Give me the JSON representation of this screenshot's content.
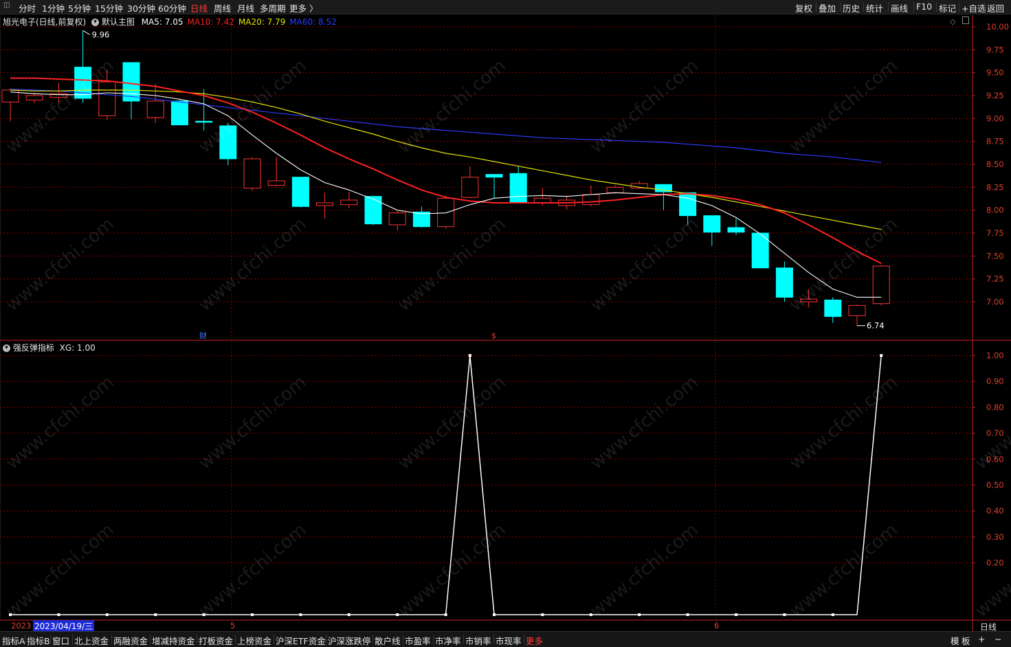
{
  "toolbar": {
    "left_items": [
      "分时",
      "1分钟",
      "5分钟",
      "15分钟",
      "30分钟",
      "60分钟",
      "日线",
      "周线",
      "月线",
      "多周期",
      "更多 〉"
    ],
    "active_index": 6,
    "right_items": [
      "复权",
      "叠加",
      "历史",
      "统计",
      "画线",
      "F10",
      "标记",
      "+自选",
      "返回"
    ]
  },
  "main_chart": {
    "stock_label": "旭光电子(日线,前复权)",
    "main_chart_label": "默认主图",
    "ma": [
      {
        "name": "MA5",
        "value": "MA5: 7.05",
        "color": "#ffffff"
      },
      {
        "name": "MA10",
        "value": "MA10: 7.42",
        "color": "#ff2222"
      },
      {
        "name": "MA20",
        "value": "MA20: 7.79",
        "color": "#e6e600"
      },
      {
        "name": "MA60",
        "value": "MA60: 8.52",
        "color": "#2a3bff"
      }
    ],
    "y_ticks": [
      "10.00",
      "9.75",
      "9.50",
      "9.25",
      "9.00",
      "8.75",
      "8.50",
      "8.25",
      "8.00",
      "7.75",
      "7.50",
      "7.25",
      "7.00"
    ],
    "high_label": "9.96",
    "low_label": "6.74",
    "marker_cai": "财",
    "marker_dollar": "$",
    "candles": [
      {
        "o": 9.18,
        "c": 9.31,
        "h": 9.33,
        "l": 8.97
      },
      {
        "o": 9.2,
        "c": 9.25,
        "h": 9.28,
        "l": 9.17
      },
      {
        "o": 9.23,
        "c": 9.27,
        "h": 9.39,
        "l": 9.17
      },
      {
        "o": 9.56,
        "c": 9.22,
        "h": 9.96,
        "l": 9.17
      },
      {
        "o": 9.03,
        "c": 9.4,
        "h": 9.53,
        "l": 8.98
      },
      {
        "o": 9.61,
        "c": 9.19,
        "h": 9.61,
        "l": 8.99
      },
      {
        "o": 9.01,
        "c": 9.19,
        "h": 9.38,
        "l": 8.95
      },
      {
        "o": 9.19,
        "c": 8.93,
        "h": 9.2,
        "l": 8.93
      },
      {
        "o": 8.97,
        "c": 8.96,
        "h": 9.32,
        "l": 8.87
      },
      {
        "o": 8.92,
        "c": 8.56,
        "h": 8.95,
        "l": 8.49
      },
      {
        "o": 8.24,
        "c": 8.56,
        "h": 8.58,
        "l": 8.21
      },
      {
        "o": 8.27,
        "c": 8.32,
        "h": 8.58,
        "l": 8.26
      },
      {
        "o": 8.36,
        "c": 8.04,
        "h": 8.36,
        "l": 8.03
      },
      {
        "o": 8.05,
        "c": 8.08,
        "h": 8.19,
        "l": 7.91
      },
      {
        "o": 8.06,
        "c": 8.11,
        "h": 8.2,
        "l": 8.02
      },
      {
        "o": 8.15,
        "c": 7.85,
        "h": 8.16,
        "l": 7.84
      },
      {
        "o": 7.84,
        "c": 7.97,
        "h": 7.99,
        "l": 7.78
      },
      {
        "o": 7.98,
        "c": 7.82,
        "h": 8.04,
        "l": 7.81
      },
      {
        "o": 7.82,
        "c": 8.13,
        "h": 8.16,
        "l": 7.8
      },
      {
        "o": 8.14,
        "c": 8.36,
        "h": 8.48,
        "l": 8.13
      },
      {
        "o": 8.39,
        "c": 8.36,
        "h": 8.39,
        "l": 8.13
      },
      {
        "o": 8.4,
        "c": 8.09,
        "h": 8.48,
        "l": 8.08
      },
      {
        "o": 8.08,
        "c": 8.13,
        "h": 8.24,
        "l": 8.05
      },
      {
        "o": 8.05,
        "c": 8.11,
        "h": 8.16,
        "l": 8.01
      },
      {
        "o": 8.06,
        "c": 8.17,
        "h": 8.27,
        "l": 8.04
      },
      {
        "o": 8.19,
        "c": 8.25,
        "h": 8.27,
        "l": 8.18
      },
      {
        "o": 8.24,
        "c": 8.29,
        "h": 8.32,
        "l": 8.23
      },
      {
        "o": 8.28,
        "c": 8.2,
        "h": 8.28,
        "l": 8.0
      },
      {
        "o": 8.19,
        "c": 7.94,
        "h": 8.19,
        "l": 7.84
      },
      {
        "o": 7.94,
        "c": 7.76,
        "h": 7.94,
        "l": 7.61
      },
      {
        "o": 7.81,
        "c": 7.76,
        "h": 7.91,
        "l": 7.73
      },
      {
        "o": 7.75,
        "c": 7.37,
        "h": 7.75,
        "l": 7.37
      },
      {
        "o": 7.37,
        "c": 7.05,
        "h": 7.44,
        "l": 7.0
      },
      {
        "o": 7.0,
        "c": 7.03,
        "h": 7.14,
        "l": 6.94
      },
      {
        "o": 7.02,
        "c": 6.84,
        "h": 7.05,
        "l": 6.77
      },
      {
        "o": 6.85,
        "c": 6.96,
        "h": 6.97,
        "l": 6.74
      },
      {
        "o": 6.98,
        "c": 7.39,
        "h": 7.4,
        "l": 6.96
      }
    ],
    "ma5": [
      9.29,
      9.27,
      9.26,
      9.26,
      9.28,
      9.27,
      9.25,
      9.21,
      9.16,
      9.03,
      8.82,
      8.62,
      8.44,
      8.3,
      8.22,
      8.12,
      8.0,
      7.96,
      7.97,
      8.06,
      8.13,
      8.15,
      8.16,
      8.15,
      8.17,
      8.19,
      8.18,
      8.17,
      8.13,
      8.05,
      7.92,
      7.74,
      7.53,
      7.32,
      7.14,
      7.05,
      7.05
    ],
    "ma10": [
      9.44,
      9.44,
      9.43,
      9.42,
      9.41,
      9.38,
      9.35,
      9.3,
      9.25,
      9.17,
      9.07,
      8.95,
      8.82,
      8.68,
      8.56,
      8.45,
      8.33,
      8.22,
      8.14,
      8.1,
      8.08,
      8.08,
      8.08,
      8.08,
      8.09,
      8.11,
      8.14,
      8.17,
      8.18,
      8.16,
      8.12,
      8.06,
      7.97,
      7.84,
      7.7,
      7.55,
      7.42
    ],
    "ma20": [
      9.31,
      9.3,
      9.3,
      9.31,
      9.31,
      9.31,
      9.3,
      9.29,
      9.27,
      9.23,
      9.18,
      9.12,
      9.05,
      8.97,
      8.9,
      8.83,
      8.75,
      8.68,
      8.62,
      8.58,
      8.53,
      8.48,
      8.43,
      8.38,
      8.33,
      8.29,
      8.25,
      8.22,
      8.18,
      8.14,
      8.09,
      8.04,
      7.99,
      7.94,
      7.89,
      7.84,
      7.79
    ],
    "ma60": [
      9.32,
      9.31,
      9.3,
      9.28,
      9.26,
      9.24,
      9.21,
      9.18,
      9.15,
      9.12,
      9.09,
      9.06,
      9.03,
      9.0,
      8.97,
      8.94,
      8.91,
      8.89,
      8.87,
      8.85,
      8.83,
      8.81,
      8.79,
      8.78,
      8.77,
      8.76,
      8.75,
      8.74,
      8.72,
      8.7,
      8.68,
      8.65,
      8.62,
      8.6,
      8.58,
      8.55,
      8.52
    ]
  },
  "sub_chart": {
    "indicator_label": "强反弹指标",
    "xg_label": "XG: 1.00",
    "y_ticks": [
      "1.00",
      "0.90",
      "0.80",
      "0.70",
      "0.60",
      "0.50",
      "0.40",
      "0.30",
      "0.20"
    ],
    "xg_values": [
      0,
      0,
      0,
      0,
      0,
      0,
      0,
      0,
      0,
      0,
      0,
      0,
      0,
      0,
      0,
      0,
      0,
      0,
      0,
      1,
      0,
      0,
      0,
      0,
      0,
      0,
      0,
      0,
      0,
      0,
      0,
      0,
      0,
      0,
      0,
      0,
      1
    ]
  },
  "time_axis": {
    "year_label": "2023",
    "cursor_date": "2023/04/19/三",
    "month_5": "5",
    "month_6": "6",
    "period_label": "日线"
  },
  "bottom_tabs": {
    "items": [
      "指标A",
      "指标B",
      "窗口",
      "北上资金",
      "两融资金",
      "增减持资金",
      "打板资金",
      "上榜资金",
      "沪深ETF资金",
      "沪深涨跌停",
      "散户线",
      "市盈率",
      "市净率",
      "市销率",
      "市现率",
      "更多"
    ],
    "active_index": 15,
    "right_items": [
      "模",
      "板",
      "+",
      "−"
    ]
  },
  "watermark": "www.cfchi.com",
  "colors": {
    "up": "#ff3333",
    "down": "#00ffff",
    "grid": "#8b0000",
    "axis": "#cc2222"
  }
}
